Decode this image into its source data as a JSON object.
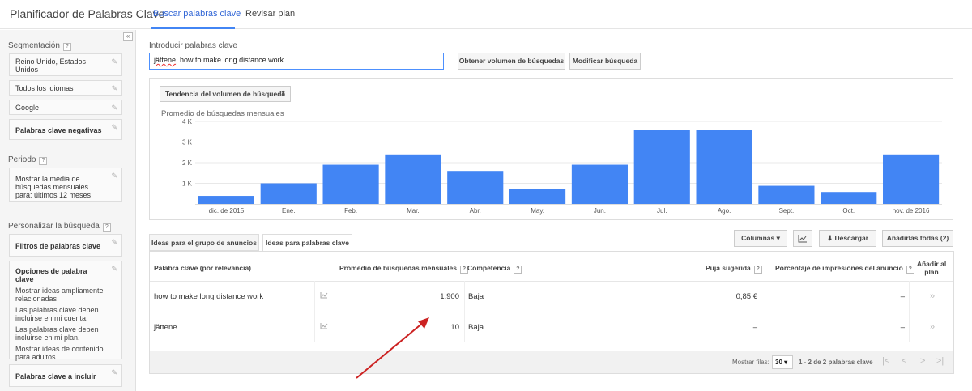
{
  "header": {
    "app_title": "Planificador de Palabras Clave",
    "tabs": [
      {
        "label": "Buscar palabras clave",
        "active": true
      },
      {
        "label": "Revisar plan",
        "active": false
      }
    ]
  },
  "sidebar": {
    "collapse_icon": "«",
    "segmentation": {
      "title": "Segmentación",
      "help": "?",
      "items": [
        "Reino Unido, Estados Unidos",
        "Todos los idiomas",
        "Google",
        "Palabras clave negativas"
      ]
    },
    "period": {
      "title": "Periodo",
      "help": "?",
      "value": "Mostrar la media de búsquedas mensuales para: últimos 12 meses"
    },
    "customize": {
      "title": "Personalizar la búsqueda",
      "help": "?",
      "filters_label": "Filtros de palabras clave",
      "options_label": "Opciones de palabra clave",
      "options": [
        "Mostrar ideas ampliamente relacionadas",
        "Las palabras clave deben incluirse en mi cuenta.",
        "Las palabras clave deben incluirse en mi plan.",
        "Mostrar ideas de contenido para adultos"
      ],
      "include_label": "Palabras clave a incluir"
    }
  },
  "search": {
    "label": "Introducir palabras clave",
    "value_first": "jättene",
    "value_rest": ", how to make long distance work",
    "btn_volume": "Obtener volumen de búsquedas",
    "btn_modify": "Modificar búsqueda"
  },
  "chart_panel": {
    "select_label": "Tendencia del volumen de búsqueda",
    "select_arrow": "⬍",
    "subtitle": "Promedio de búsquedas mensuales"
  },
  "chart_data": {
    "type": "bar",
    "categories": [
      "dic. de 2015",
      "Ene.",
      "Feb.",
      "Mar.",
      "Abr.",
      "May.",
      "Jun.",
      "Jul.",
      "Ago.",
      "Sept.",
      "Oct.",
      "nov. de 2016"
    ],
    "values": [
      390,
      1000,
      1900,
      2400,
      1600,
      720,
      1900,
      3600,
      3600,
      880,
      580,
      2400
    ],
    "yticks": [
      "1 K",
      "2 K",
      "3 K",
      "4 K"
    ],
    "ytick_values": [
      1000,
      2000,
      3000,
      4000
    ],
    "ylim": [
      0,
      4000
    ],
    "bar_color": "#4285f4",
    "grid": true
  },
  "tabs": {
    "ad_groups": "Ideas para el grupo de anuncios",
    "keywords": "Ideas para palabras clave"
  },
  "toolbar": {
    "columns": "Columnas",
    "columns_arrow": "▾",
    "chart_icon": "chart-icon",
    "download": "Descargar",
    "download_icon": "⬇",
    "add_all": "Añadirlas todas (2)"
  },
  "table": {
    "headers": {
      "keyword": "Palabra clave (por relevancia)",
      "avg": "Promedio de búsquedas mensuales",
      "competition": "Competencia",
      "bid": "Puja sugerida",
      "impressions": "Porcentaje de impresiones del anuncio",
      "add": "Añadir al plan"
    },
    "help": "?",
    "rows": [
      {
        "keyword": "how to make long distance work",
        "avg": "1.900",
        "competition": "Baja",
        "bid": "0,85 €",
        "impressions": "–",
        "add": "»"
      },
      {
        "keyword": "jättene",
        "avg": "10",
        "competition": "Baja",
        "bid": "–",
        "impressions": "–",
        "add": "»"
      }
    ],
    "footer": {
      "rows_label": "Mostrar filas:",
      "rows_value": "30",
      "rows_arrow": "▾",
      "range": "1 - 2 de 2 palabras clave",
      "first": "|<",
      "prev": "<",
      "next": ">",
      "last": ">|"
    }
  },
  "colors": {
    "accent": "#4285f4",
    "annotation_arrow": "#cc2222"
  }
}
